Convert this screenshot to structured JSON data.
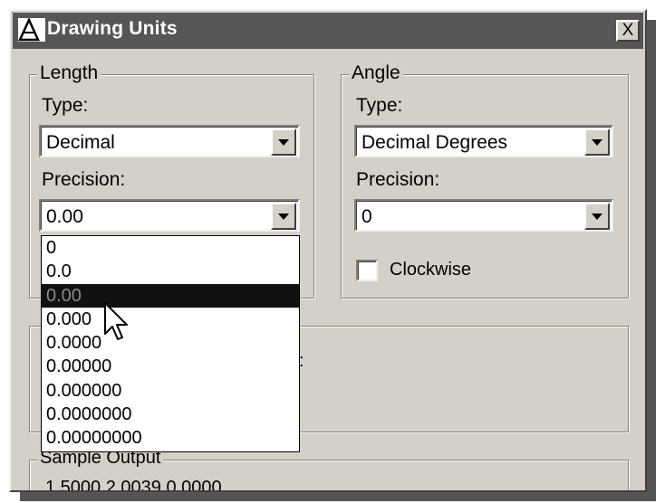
{
  "window": {
    "title": "Drawing Units",
    "close_label": "X"
  },
  "length": {
    "group_label": "Length",
    "type_label": "Type:",
    "type_value": "Decimal",
    "precision_label": "Precision:",
    "precision_value": "0.00",
    "precision_options": [
      "0",
      "0.0",
      "0.00",
      "0.000",
      "0.0000",
      "0.00000",
      "0.000000",
      "0.0000000",
      "0.00000000"
    ],
    "selected_option": "0.00"
  },
  "angle": {
    "group_label": "Angle",
    "type_label": "Type:",
    "type_value": "Decimal Degrees",
    "precision_label": "Precision:",
    "precision_value": "0",
    "clockwise_label": "Clockwise",
    "clockwise_checked": false
  },
  "middle_group": {
    "partial_text": ":"
  },
  "sample_output": {
    "label": "Sample Output",
    "value": "1.5000,2.0039,0.0000"
  },
  "icons": {
    "app": "autocad-app-icon",
    "cursor": "mouse-pointer-icon",
    "dropdown_arrow": "triangle-down-icon"
  },
  "colors": {
    "title_bar": "#565656",
    "dialog_bg": "#d4d0c8",
    "selection": "#111111"
  }
}
